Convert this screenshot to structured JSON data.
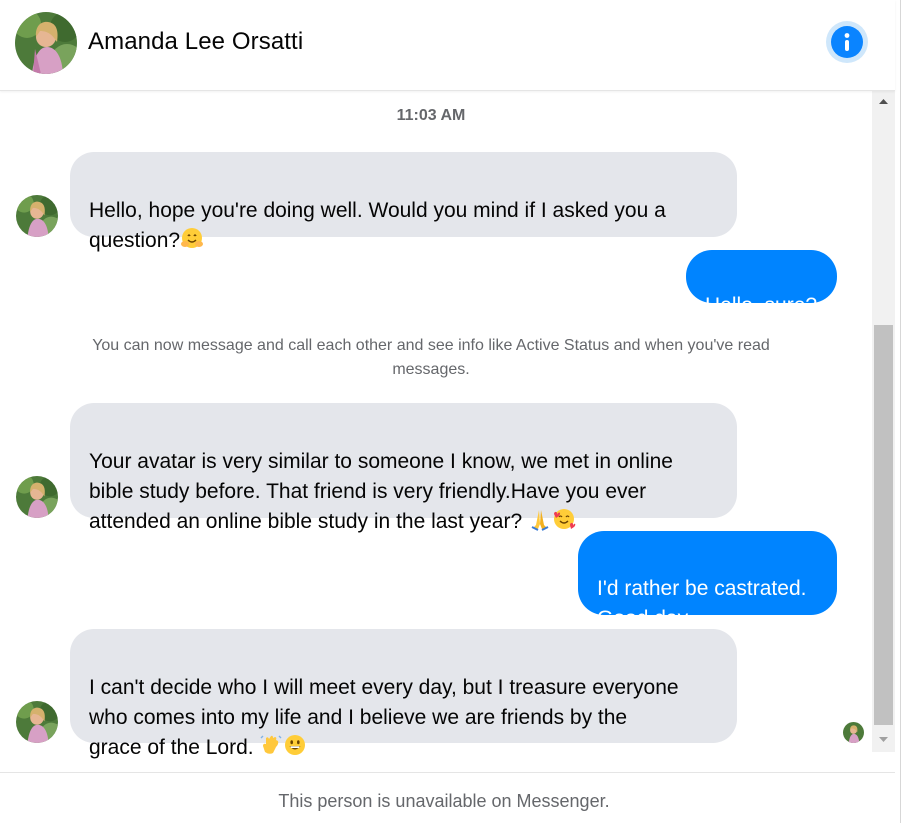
{
  "header": {
    "contact_name": "Amanda Lee Orsatti",
    "avatar_icon": "profile-photo",
    "info_icon": "info-icon"
  },
  "thread": {
    "timestamp": "11:03 AM",
    "notice": "You can now message and call each other and see info like Active Status and when you've read messages.",
    "messages": [
      {
        "direction": "incoming",
        "text": "Hello,  hope you're doing well. Would you mind if I asked you a\nquestion?",
        "emoji": "hugging-face-emoji"
      },
      {
        "direction": "outgoing",
        "text": "Hello, sure?"
      },
      {
        "direction": "incoming",
        "text": "Your avatar is very similar to someone I know, we met in online\nbible study before. That friend is very friendly.Have you ever\nattended an online bible study in the last year? ",
        "emoji": "folded-hands-and-smiling-face-with-hearts-emoji"
      },
      {
        "direction": "outgoing",
        "text": "I'd rather be castrated.\nGood day."
      },
      {
        "direction": "incoming",
        "text": "I can't decide who I will meet every day, but I treasure everyone\nwho comes into my life and I believe we are friends by the\ngrace of the Lord. ",
        "emoji": "waving-hand-and-grinning-face-emoji"
      }
    ]
  },
  "footer": {
    "status_text": "This person is unavailable on Messenger."
  },
  "colors": {
    "outgoing_bubble": "#0084ff",
    "incoming_bubble": "#e4e6eb",
    "info_accent": "#0a84ff",
    "muted_text": "#65676b"
  }
}
